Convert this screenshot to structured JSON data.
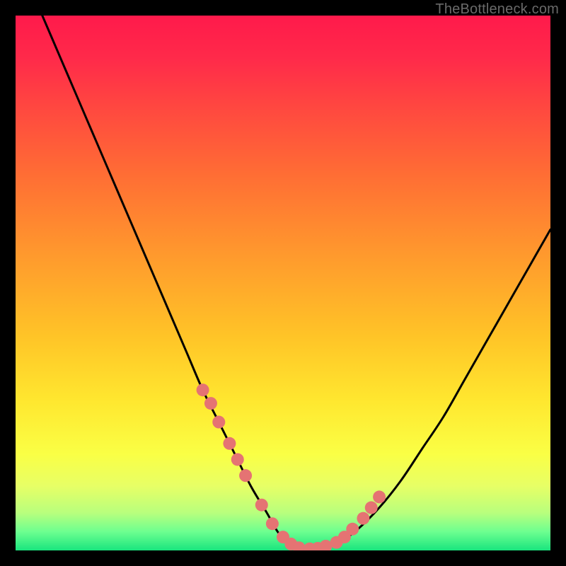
{
  "watermark": "TheBottleneck.com",
  "chart_data": {
    "type": "line",
    "title": "",
    "xlabel": "",
    "ylabel": "",
    "xlim": [
      0,
      100
    ],
    "ylim": [
      0,
      100
    ],
    "grid": false,
    "legend": false,
    "background_gradient_stops": [
      {
        "offset": 0.0,
        "color": "#ff1a4b"
      },
      {
        "offset": 0.08,
        "color": "#ff2a4a"
      },
      {
        "offset": 0.18,
        "color": "#ff4a3f"
      },
      {
        "offset": 0.3,
        "color": "#ff6e34"
      },
      {
        "offset": 0.45,
        "color": "#ff9a2d"
      },
      {
        "offset": 0.6,
        "color": "#ffc427"
      },
      {
        "offset": 0.72,
        "color": "#ffe72f"
      },
      {
        "offset": 0.82,
        "color": "#faff45"
      },
      {
        "offset": 0.88,
        "color": "#e7ff66"
      },
      {
        "offset": 0.93,
        "color": "#b8ff7d"
      },
      {
        "offset": 0.965,
        "color": "#6dff90"
      },
      {
        "offset": 1.0,
        "color": "#19e57e"
      }
    ],
    "series": [
      {
        "name": "bottleneck-curve",
        "type": "line",
        "x": [
          5,
          8,
          11,
          14,
          17,
          20,
          23,
          26,
          29,
          32,
          35,
          38,
          41,
          44,
          47,
          49,
          51,
          53,
          56,
          60,
          64,
          68,
          72,
          76,
          80,
          84,
          88,
          92,
          96,
          100
        ],
        "y": [
          100,
          93,
          86,
          79,
          72,
          65,
          58,
          51,
          44,
          37,
          30,
          24,
          18,
          12,
          7,
          3.5,
          1.2,
          0.3,
          0.2,
          1.2,
          4,
          8,
          13,
          19,
          25,
          32,
          39,
          46,
          53,
          60
        ]
      },
      {
        "name": "highlight-markers",
        "type": "scatter",
        "x": [
          35,
          36.5,
          38,
          40,
          41.5,
          43,
          46,
          48,
          50,
          51.5,
          53,
          55,
          56.5,
          58,
          60,
          61.5,
          63,
          65,
          66.5,
          68
        ],
        "y": [
          30,
          27.5,
          24,
          20,
          17,
          14,
          8.5,
          5,
          2.5,
          1.2,
          0.5,
          0.3,
          0.4,
          0.8,
          1.5,
          2.5,
          4,
          6,
          8,
          10
        ]
      }
    ],
    "curve_color": "#000000",
    "curve_width": 3,
    "marker_color": "#e57373",
    "marker_radius": 9
  }
}
